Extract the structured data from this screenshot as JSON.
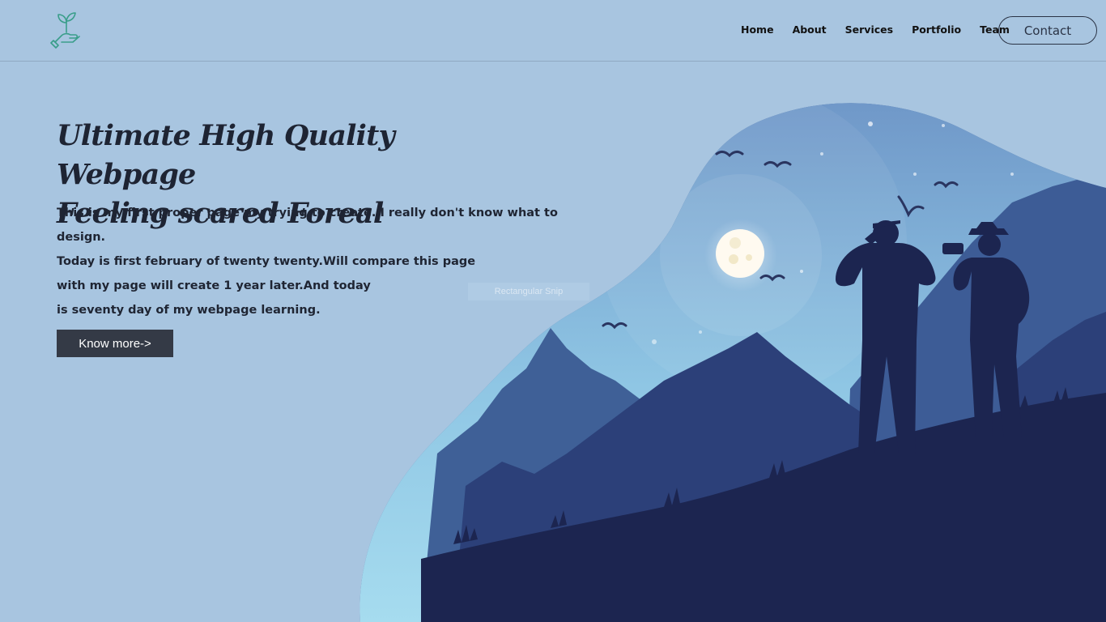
{
  "header": {
    "logo_icon": "plant-in-hand-icon",
    "nav": [
      {
        "label": "Home"
      },
      {
        "label": "About"
      },
      {
        "label": "Services"
      },
      {
        "label": "Portfolio"
      },
      {
        "label": "Team"
      }
    ],
    "contact_label": "Contact"
  },
  "hero": {
    "headline_line1": "Ultimate High Quality Webpage",
    "headline_line2": "Feeling scared Foreal",
    "paragraph_lines": [
      "This is my first proper page my trying to create. I really don't know what to",
      "design.",
      "Today is first february of twenty twenty.Will compare this page",
      "with my page will create 1 year later.And today",
      "is seventy day of my webpage learning."
    ],
    "button_label": "Know more->"
  },
  "overlay": {
    "snip_label": "Rectangular Snip"
  },
  "illustration": {
    "icon": "hikers-night-mountain-illustration",
    "colors": {
      "background": "#a8c5e0",
      "sky": "#8fc4e0",
      "far_mountains": "#3f5f98",
      "mid_mountains": "#2b3f78",
      "foreground": "#1c2550",
      "moon": "#fff9e8"
    }
  }
}
